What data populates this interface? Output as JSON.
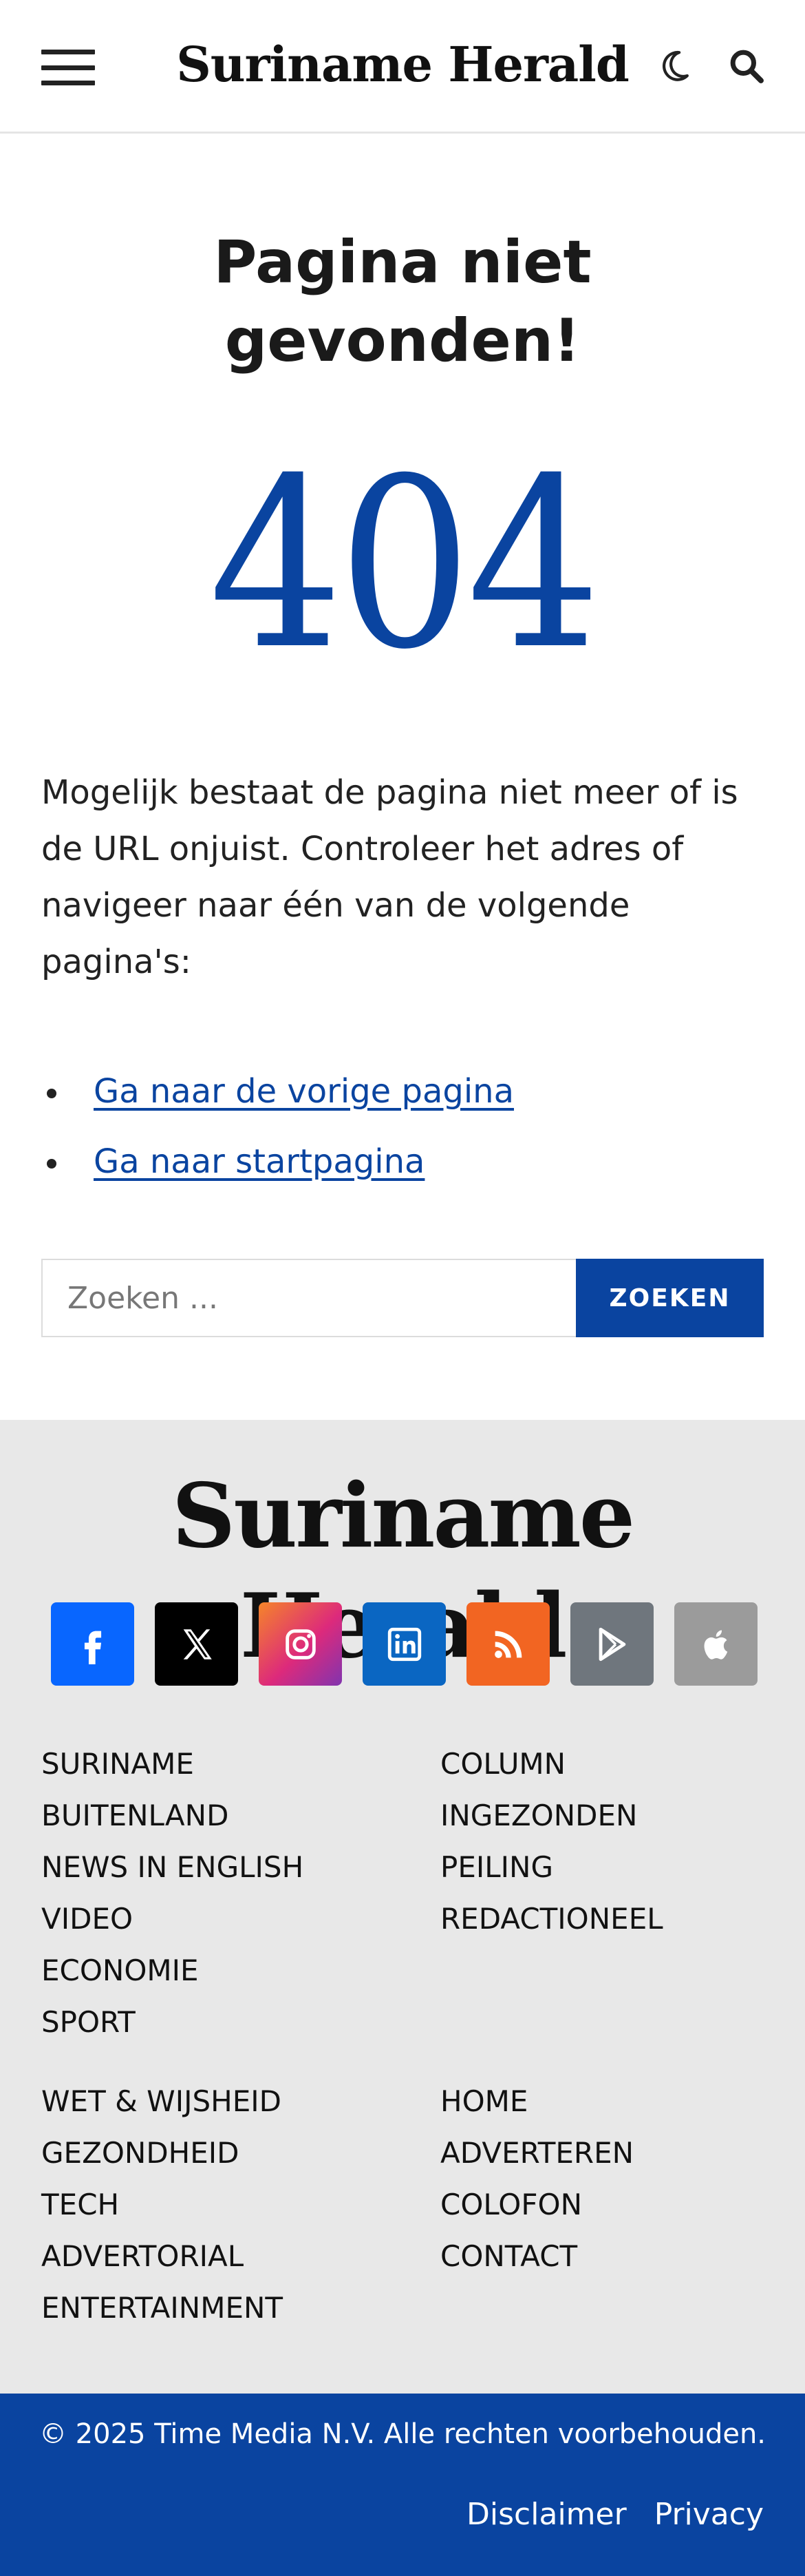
{
  "header": {
    "logo": "Suriname Herald",
    "menu_icon": "hamburger-menu-icon",
    "dark_mode_icon": "moon-icon",
    "search_icon": "search-icon"
  },
  "main": {
    "title": "Pagina niet gevonden!",
    "error_code": "404",
    "intro": "Mogelijk bestaat de pagina niet meer of is de URL onjuist. Controleer het adres of navigeer naar één van de volgende pagina's:",
    "links": [
      {
        "label": "Ga naar de vorige pagina"
      },
      {
        "label": "Ga naar startpagina"
      }
    ],
    "search": {
      "placeholder": "Zoeken ...",
      "button": "ZOEKEN"
    }
  },
  "footer": {
    "logo": "Suriname Herald",
    "social": [
      {
        "name": "facebook-icon",
        "color": "#0866ff"
      },
      {
        "name": "x-icon",
        "color": "#000000"
      },
      {
        "name": "instagram-icon",
        "color": "#e1306c"
      },
      {
        "name": "linkedin-icon",
        "color": "#0a66c2"
      },
      {
        "name": "rss-icon",
        "color": "#f26522"
      },
      {
        "name": "google-play-icon",
        "color": "#6f767d"
      },
      {
        "name": "apple-icon",
        "color": "#9b9b9b"
      }
    ],
    "menu1": {
      "left": [
        "SURINAME",
        "BUITENLAND",
        "NEWS IN ENGLISH",
        "VIDEO",
        "ECONOMIE",
        "SPORT"
      ],
      "right": [
        "COLUMN",
        "INGEZONDEN",
        "PEILING",
        "REDACTIONEEL"
      ]
    },
    "menu2": {
      "left": [
        "WET & WIJSHEID",
        "GEZONDHEID",
        "TECH",
        "ADVERTORIAL",
        "ENTERTAINMENT"
      ],
      "right": [
        "HOME",
        "ADVERTEREN",
        "COLOFON",
        "CONTACT"
      ]
    },
    "copyright": "© 2025 Time Media N.V. Alle rechten voorbehouden.",
    "legal": [
      "Disclaimer",
      "Privacy"
    ]
  },
  "colors": {
    "accent": "#0a44a0",
    "footer_bg": "#e8e8e8"
  }
}
